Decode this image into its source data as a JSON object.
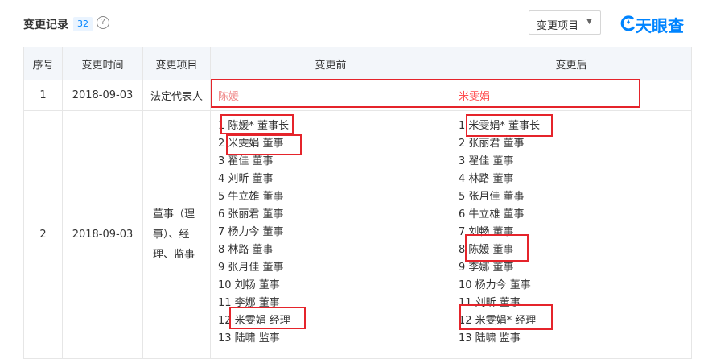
{
  "header": {
    "title": "变更记录",
    "count": "32",
    "help_icon": "question-circle-icon",
    "dropdown_label": "变更项目",
    "logo_text": "天眼查",
    "logo_color": "#0084ff"
  },
  "table": {
    "columns": [
      "序号",
      "变更时间",
      "变更项目",
      "变更前",
      "变更后"
    ],
    "rows": [
      {
        "index": "1",
        "date": "2018-09-03",
        "item": "法定代表人",
        "before": "陈媛",
        "after": "米雯娟"
      },
      {
        "index": "2",
        "date": "2018-09-03",
        "item_lines": [
          "董事（理",
          "事）、经",
          "理、监事"
        ],
        "before_list": [
          "1 陈媛* 董事长",
          "2 米雯娟 董事",
          "3 翟佳 董事",
          "4 刘昕 董事",
          "5 牛立雄 董事",
          "6 张丽君 董事",
          "7 杨力今 董事",
          "8 林路 董事",
          "9 张月佳 董事",
          "10 刘畅 董事",
          "11 李娜 董事",
          "12 米雯娟 经理",
          "13 陆啸 监事"
        ],
        "after_list": [
          "1 米雯娟* 董事长",
          "2 张丽君 董事",
          "3 翟佳 董事",
          "4 林路 董事",
          "5 张月佳 董事",
          "6 牛立雄 董事",
          "7 刘畅 董事",
          "8 陈媛 董事",
          "9 李娜 董事",
          "10 杨力今 董事",
          "11 刘昕 董事",
          "12 米雯娟* 经理",
          "13 陆啸 监事"
        ]
      }
    ]
  },
  "colors": {
    "header_bg": "#f3f6fa",
    "border": "#e6e6e6",
    "annotation": "#e5242b",
    "deleted_text": "#f08b8b",
    "new_text": "#ff4d4f"
  }
}
